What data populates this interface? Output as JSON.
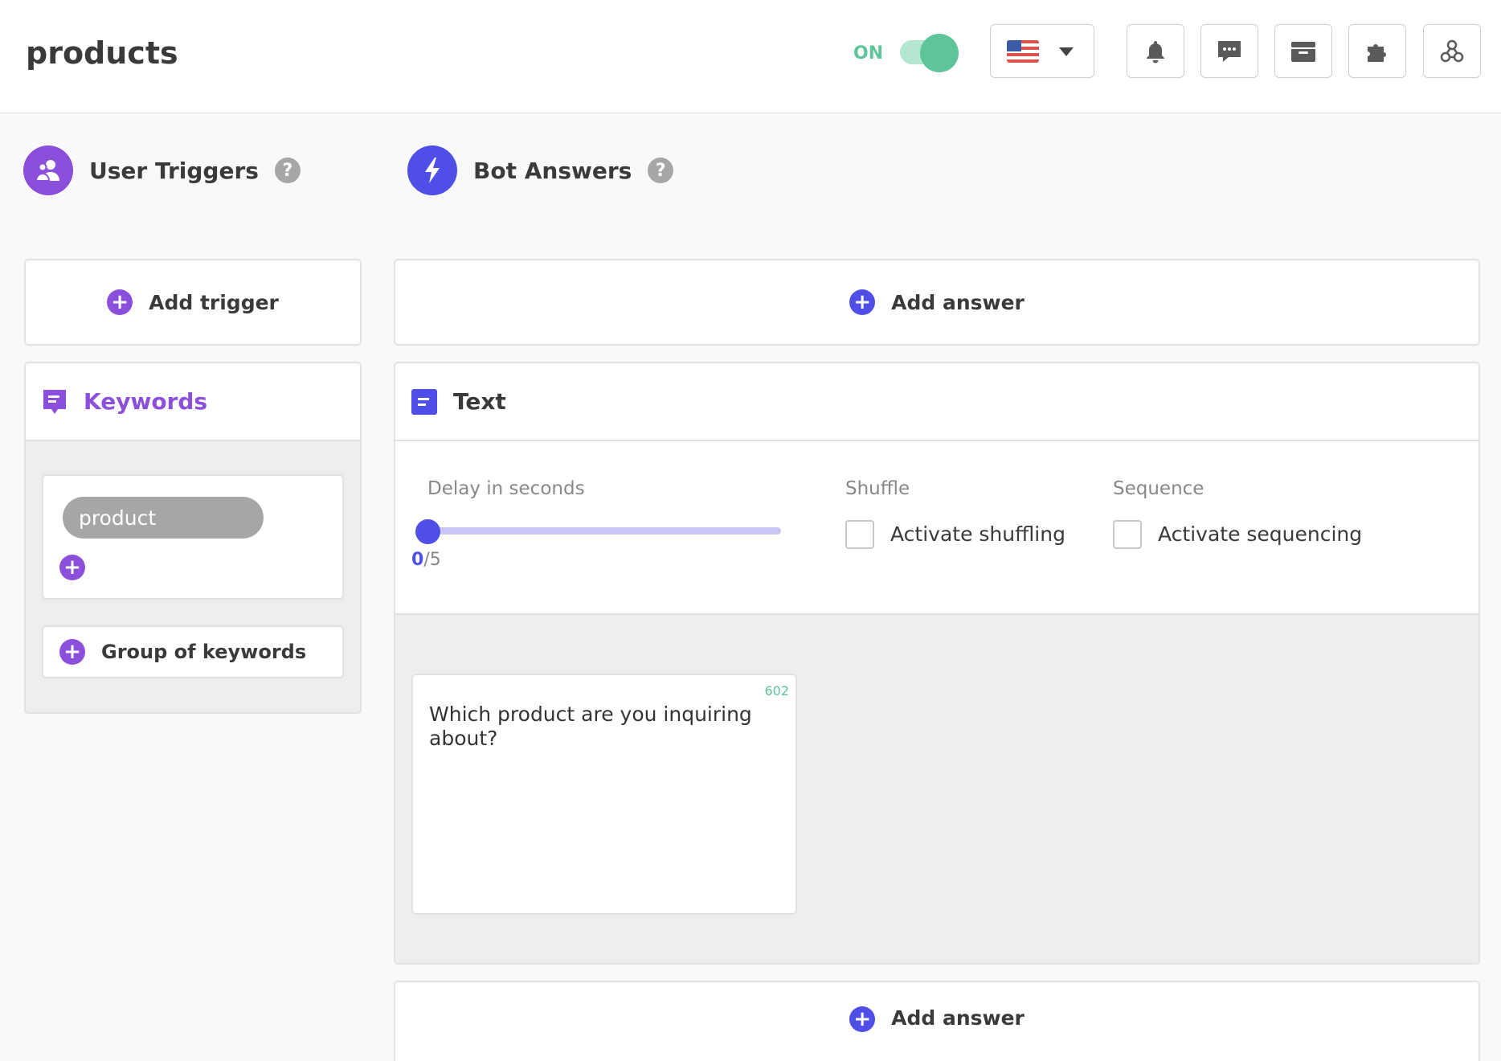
{
  "header": {
    "title": "products",
    "status_label": "ON",
    "toggle_on": true,
    "language": "en-US",
    "icons": [
      "bell-icon",
      "chat-icon",
      "inbox-icon",
      "puzzle-icon",
      "network-icon"
    ]
  },
  "triggers": {
    "title": "User Triggers",
    "help": "?",
    "add_label": "Add trigger",
    "keywords_title": "Keywords",
    "keyword_tags": [
      "product"
    ],
    "group_label": "Group of keywords"
  },
  "answers": {
    "title": "Bot Answers",
    "help": "?",
    "add_label": "Add answer",
    "add_label_bottom": "Add answer",
    "block_title": "Text",
    "delay_label": "Delay in seconds",
    "delay_value": "0",
    "delay_max": "/5",
    "shuffle_label": "Shuffle",
    "shuffle_option": "Activate shuffling",
    "sequence_label": "Sequence",
    "sequence_option": "Activate sequencing",
    "message": {
      "text": "Which product are you inquiring about?",
      "char_count": "602"
    }
  },
  "colors": {
    "purple": "#8b4fdc",
    "blue": "#4f4fe8",
    "green": "#5ec49a",
    "gray_tag": "#a6a6a6"
  }
}
